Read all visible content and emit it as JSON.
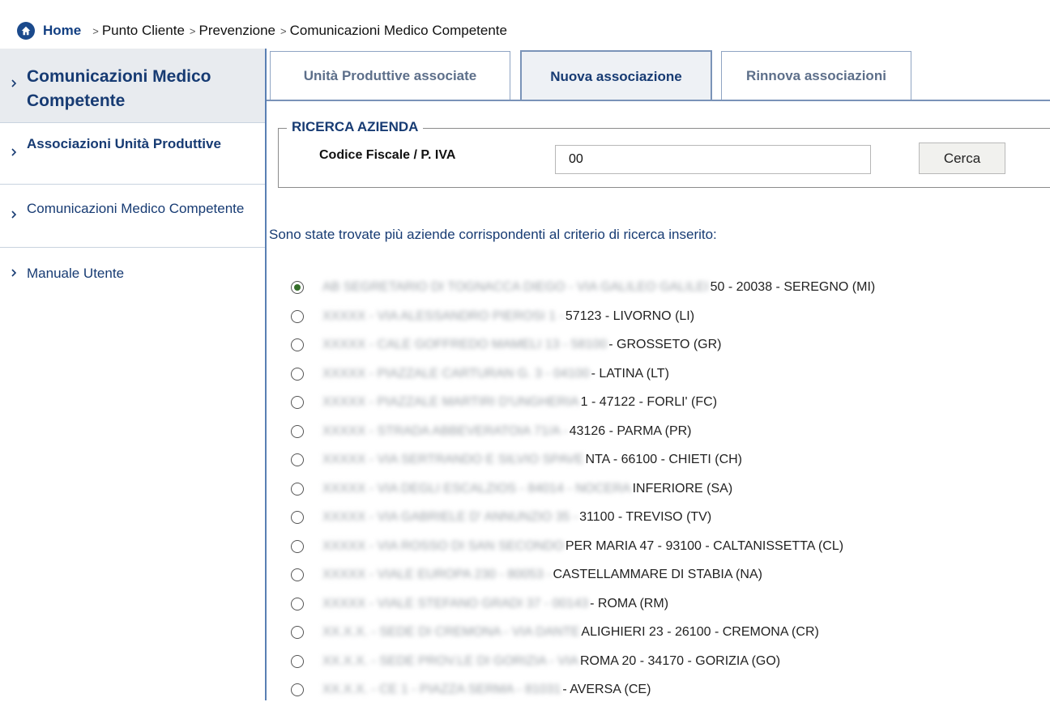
{
  "breadcrumb": {
    "home": "Home",
    "items": [
      "Punto Cliente",
      "Prevenzione",
      "Comunicazioni Medico Competente"
    ]
  },
  "sidebar": {
    "header": "Comunicazioni Medico Competente",
    "items": [
      {
        "label": "Associazioni Unità Produttive"
      },
      {
        "label": "Comunicazioni Medico Competente"
      },
      {
        "label": "Manuale Utente"
      }
    ]
  },
  "tabs": [
    {
      "label": "Unità Produttive associate",
      "active": false
    },
    {
      "label": "Nuova associazione",
      "active": true
    },
    {
      "label": "Rinnova associazioni",
      "active": false
    }
  ],
  "search": {
    "legend": "RICERCA AZIENDA",
    "field_label": "Codice Fiscale / P. IVA",
    "field_value": "00",
    "button_label": "Cerca"
  },
  "results": {
    "message": "Sono state trovate più aziende corrispondenti al criterio di ricerca inserito:",
    "items": [
      {
        "hidden": "AB SEGRETARIO DI TOGNACCA DIEGO - VIA GALILEO GALILEI",
        "visible": "50 - 20038 - SEREGNO (MI)",
        "checked": true
      },
      {
        "hidden": "XXXXX - VIA ALESSANDRO PIEROSI 1 -",
        "visible": "57123 - LIVORNO (LI)",
        "checked": false
      },
      {
        "hidden": "XXXXX - CALE GOFFREDO MAMELI 13 - 58100",
        "visible": "- GROSSETO (GR)",
        "checked": false
      },
      {
        "hidden": "XXXXX - PIAZZALE CARTURAN G. 3 - 04100",
        "visible": "- LATINA (LT)",
        "checked": false
      },
      {
        "hidden": "XXXXX - PIAZZALE MARTIRI D'UNGHERIA",
        "visible": "1 - 47122 - FORLI' (FC)",
        "checked": false
      },
      {
        "hidden": "XXXXX - STRADA ABBEVERATOIA 71/A -",
        "visible": "43126 - PARMA (PR)",
        "checked": false
      },
      {
        "hidden": "XXXXX - VIA SERTRANDO E SILVIO SPAVE",
        "visible": "NTA - 66100 - CHIETI (CH)",
        "checked": false
      },
      {
        "hidden": "XXXXX - VIA DEGLI ESCALZIOS - 84014 - NOCERA",
        "visible": "INFERIORE (SA)",
        "checked": false
      },
      {
        "hidden": "XXXXX - VIA GABRIELE D' ANNUNZIO 35 -",
        "visible": "31100 - TREVISO (TV)",
        "checked": false
      },
      {
        "hidden": "XXXXX - VIA ROSSO DI SAN SECONDO",
        "visible": "PER MARIA 47 - 93100 - CALTANISSETTA (CL)",
        "checked": false
      },
      {
        "hidden": "XXXXX - VIALE EUROPA 230 - 80053 -",
        "visible": "CASTELLAMMARE DI STABIA (NA)",
        "checked": false
      },
      {
        "hidden": "XXXXX - VIALE STEFANO GRADI 37 - 00143",
        "visible": "- ROMA (RM)",
        "checked": false
      },
      {
        "hidden": "XX.X.X. - SEDE DI CREMONA - VIA DANTE",
        "visible": "ALIGHIERI 23 - 26100 - CREMONA (CR)",
        "checked": false
      },
      {
        "hidden": "XX.X.X. - SEDE PROV.LE DI GORIZIA - VIA",
        "visible": "ROMA 20 - 34170 - GORIZIA (GO)",
        "checked": false
      },
      {
        "hidden": "XX.X.X. - CE 1 - PIAZZA SERMA - 81031",
        "visible": "- AVERSA (CE)",
        "checked": false
      }
    ]
  },
  "colors": {
    "brand_blue": "#173b73",
    "border_blue": "#7a93b8",
    "sidebar_header_bg": "#e8ebef",
    "selected_radio": "#356e2a"
  }
}
